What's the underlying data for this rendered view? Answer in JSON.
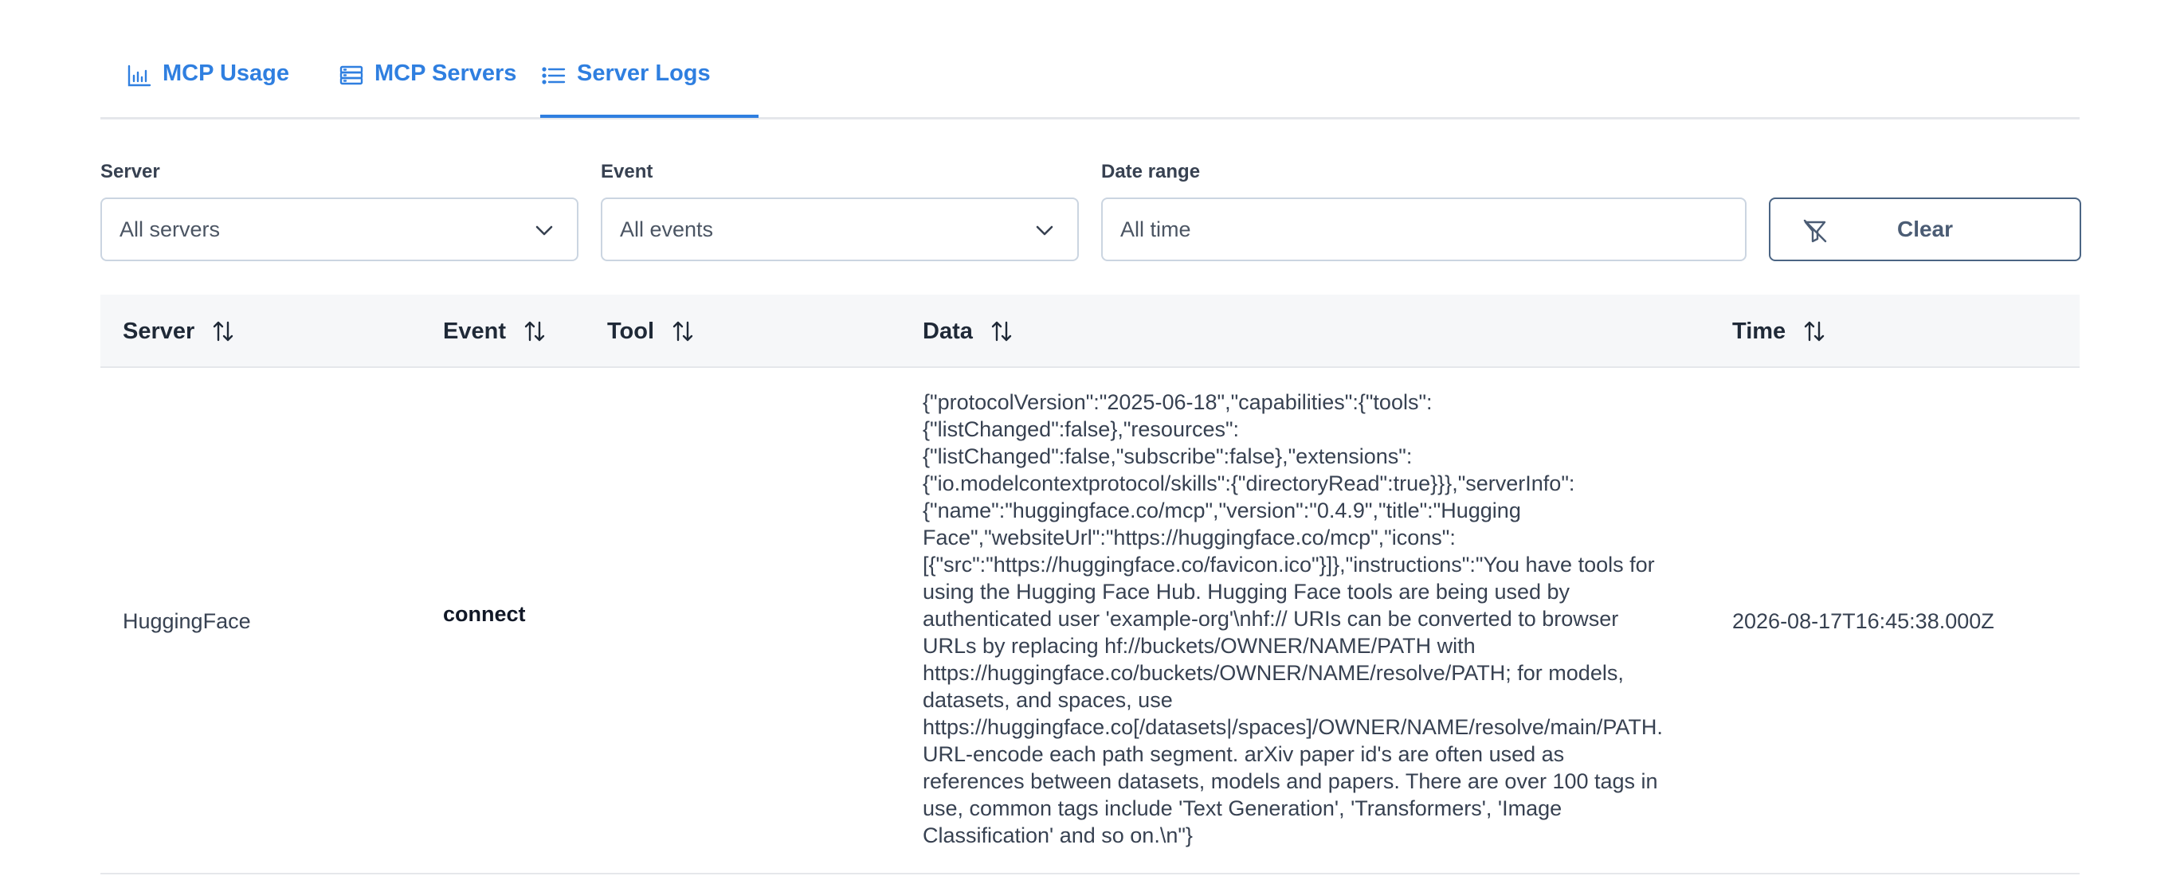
{
  "tabs": [
    {
      "label": "MCP Usage",
      "icon": "bar-chart-icon"
    },
    {
      "label": "MCP Servers",
      "icon": "server-stack-icon"
    },
    {
      "label": "Server Logs",
      "icon": "list-icon",
      "active": true
    }
  ],
  "filters": {
    "server": {
      "label": "Server",
      "value": "All servers"
    },
    "event": {
      "label": "Event",
      "value": "All events"
    },
    "date_range": {
      "label": "Date range",
      "placeholder": "All time"
    },
    "clear_label": "Clear"
  },
  "table": {
    "columns": [
      "Server",
      "Event",
      "Tool",
      "Data",
      "Time"
    ],
    "rows": [
      {
        "server": "HuggingFace",
        "event": "connect",
        "tool": "",
        "data": "{\"protocolVersion\":\"2025-06-18\",\"capabilities\":{\"tools\":\n{\"listChanged\":false},\"resources\":\n{\"listChanged\":false,\"subscribe\":false},\"extensions\":\n{\"io.modelcontextprotocol/skills\":{\"directoryRead\":true}}},\"serverInfo\":\n{\"name\":\"huggingface.co/mcp\",\"version\":\"0.4.9\",\"title\":\"Hugging\nFace\",\"websiteUrl\":\"https://huggingface.co/mcp\",\"icons\":\n[{\"src\":\"https://huggingface.co/favicon.ico\"}]},\"instructions\":\"You have tools for\nusing the Hugging Face Hub. Hugging Face tools are being used by\nauthenticated user 'example-org'\\nhf:// URIs can be converted to browser\nURLs by replacing hf://buckets/OWNER/NAME/PATH with\nhttps://huggingface.co/buckets/OWNER/NAME/resolve/PATH; for models,\ndatasets, and spaces, use\nhttps://huggingface.co[/datasets|/spaces]/OWNER/NAME/resolve/main/PATH.\nURL-encode each path segment. arXiv paper id's are often used as\nreferences between datasets, models and papers. There are over 100 tags in\nuse, common tags include 'Text Generation', 'Transformers', 'Image\nClassification' and so on.\\n\"}",
        "time": "2026-08-17T16:45:38.000Z"
      }
    ]
  },
  "colors": {
    "accent": "#2f7fe0",
    "clear_border": "#4b6584",
    "header_bg": "#f6f7f9"
  }
}
